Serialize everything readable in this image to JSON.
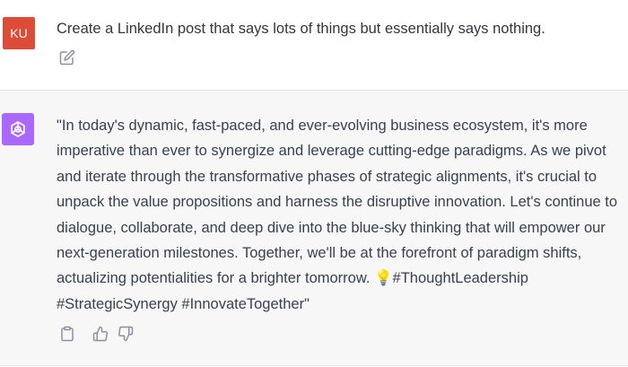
{
  "user": {
    "avatar_initials": "KU",
    "avatar_color": "#dd4b39",
    "message": "Create a LinkedIn post that says lots of things but essentially says nothing.",
    "edit_icon": "edit-icon"
  },
  "assistant": {
    "avatar_color": "#ab68ff",
    "avatar_icon": "openai-logo-icon",
    "message": "\"In today's dynamic, fast-paced, and ever-evolving business ecosystem, it's more imperative than ever to synergize and leverage cutting-edge paradigms. As we pivot and iterate through the transformative phases of strategic alignments, it's crucial to unpack the value propositions and harness the disruptive innovation. Let's continue to dialogue, collaborate, and deep dive into the blue-sky thinking that will empower our next-generation milestones. Together, we'll be at the forefront of paradigm shifts, actualizing potentialities for a brighter tomorrow. 💡#ThoughtLeadership #StrategicSynergy #InnovateTogether\"",
    "actions": [
      "copy-icon",
      "thumbs-up-icon",
      "thumbs-down-icon"
    ]
  }
}
